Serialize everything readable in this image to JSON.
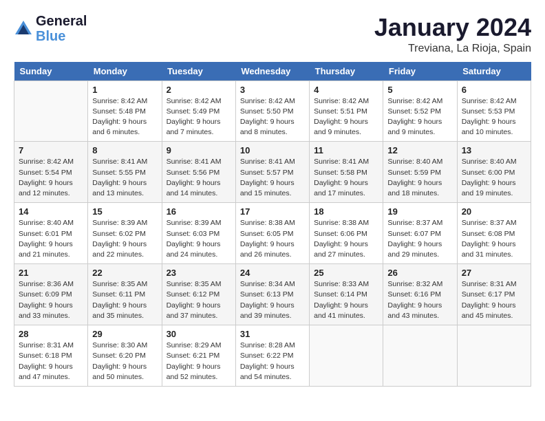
{
  "header": {
    "logo_line1": "General",
    "logo_line2": "Blue",
    "month": "January 2024",
    "location": "Treviana, La Rioja, Spain"
  },
  "weekdays": [
    "Sunday",
    "Monday",
    "Tuesday",
    "Wednesday",
    "Thursday",
    "Friday",
    "Saturday"
  ],
  "weeks": [
    [
      {
        "day": "",
        "sunrise": "",
        "sunset": "",
        "daylight": ""
      },
      {
        "day": "1",
        "sunrise": "Sunrise: 8:42 AM",
        "sunset": "Sunset: 5:48 PM",
        "daylight": "Daylight: 9 hours and 6 minutes."
      },
      {
        "day": "2",
        "sunrise": "Sunrise: 8:42 AM",
        "sunset": "Sunset: 5:49 PM",
        "daylight": "Daylight: 9 hours and 7 minutes."
      },
      {
        "day": "3",
        "sunrise": "Sunrise: 8:42 AM",
        "sunset": "Sunset: 5:50 PM",
        "daylight": "Daylight: 9 hours and 8 minutes."
      },
      {
        "day": "4",
        "sunrise": "Sunrise: 8:42 AM",
        "sunset": "Sunset: 5:51 PM",
        "daylight": "Daylight: 9 hours and 9 minutes."
      },
      {
        "day": "5",
        "sunrise": "Sunrise: 8:42 AM",
        "sunset": "Sunset: 5:52 PM",
        "daylight": "Daylight: 9 hours and 9 minutes."
      },
      {
        "day": "6",
        "sunrise": "Sunrise: 8:42 AM",
        "sunset": "Sunset: 5:53 PM",
        "daylight": "Daylight: 9 hours and 10 minutes."
      }
    ],
    [
      {
        "day": "7",
        "sunrise": "Sunrise: 8:42 AM",
        "sunset": "Sunset: 5:54 PM",
        "daylight": "Daylight: 9 hours and 12 minutes."
      },
      {
        "day": "8",
        "sunrise": "Sunrise: 8:41 AM",
        "sunset": "Sunset: 5:55 PM",
        "daylight": "Daylight: 9 hours and 13 minutes."
      },
      {
        "day": "9",
        "sunrise": "Sunrise: 8:41 AM",
        "sunset": "Sunset: 5:56 PM",
        "daylight": "Daylight: 9 hours and 14 minutes."
      },
      {
        "day": "10",
        "sunrise": "Sunrise: 8:41 AM",
        "sunset": "Sunset: 5:57 PM",
        "daylight": "Daylight: 9 hours and 15 minutes."
      },
      {
        "day": "11",
        "sunrise": "Sunrise: 8:41 AM",
        "sunset": "Sunset: 5:58 PM",
        "daylight": "Daylight: 9 hours and 17 minutes."
      },
      {
        "day": "12",
        "sunrise": "Sunrise: 8:40 AM",
        "sunset": "Sunset: 5:59 PM",
        "daylight": "Daylight: 9 hours and 18 minutes."
      },
      {
        "day": "13",
        "sunrise": "Sunrise: 8:40 AM",
        "sunset": "Sunset: 6:00 PM",
        "daylight": "Daylight: 9 hours and 19 minutes."
      }
    ],
    [
      {
        "day": "14",
        "sunrise": "Sunrise: 8:40 AM",
        "sunset": "Sunset: 6:01 PM",
        "daylight": "Daylight: 9 hours and 21 minutes."
      },
      {
        "day": "15",
        "sunrise": "Sunrise: 8:39 AM",
        "sunset": "Sunset: 6:02 PM",
        "daylight": "Daylight: 9 hours and 22 minutes."
      },
      {
        "day": "16",
        "sunrise": "Sunrise: 8:39 AM",
        "sunset": "Sunset: 6:03 PM",
        "daylight": "Daylight: 9 hours and 24 minutes."
      },
      {
        "day": "17",
        "sunrise": "Sunrise: 8:38 AM",
        "sunset": "Sunset: 6:05 PM",
        "daylight": "Daylight: 9 hours and 26 minutes."
      },
      {
        "day": "18",
        "sunrise": "Sunrise: 8:38 AM",
        "sunset": "Sunset: 6:06 PM",
        "daylight": "Daylight: 9 hours and 27 minutes."
      },
      {
        "day": "19",
        "sunrise": "Sunrise: 8:37 AM",
        "sunset": "Sunset: 6:07 PM",
        "daylight": "Daylight: 9 hours and 29 minutes."
      },
      {
        "day": "20",
        "sunrise": "Sunrise: 8:37 AM",
        "sunset": "Sunset: 6:08 PM",
        "daylight": "Daylight: 9 hours and 31 minutes."
      }
    ],
    [
      {
        "day": "21",
        "sunrise": "Sunrise: 8:36 AM",
        "sunset": "Sunset: 6:09 PM",
        "daylight": "Daylight: 9 hours and 33 minutes."
      },
      {
        "day": "22",
        "sunrise": "Sunrise: 8:35 AM",
        "sunset": "Sunset: 6:11 PM",
        "daylight": "Daylight: 9 hours and 35 minutes."
      },
      {
        "day": "23",
        "sunrise": "Sunrise: 8:35 AM",
        "sunset": "Sunset: 6:12 PM",
        "daylight": "Daylight: 9 hours and 37 minutes."
      },
      {
        "day": "24",
        "sunrise": "Sunrise: 8:34 AM",
        "sunset": "Sunset: 6:13 PM",
        "daylight": "Daylight: 9 hours and 39 minutes."
      },
      {
        "day": "25",
        "sunrise": "Sunrise: 8:33 AM",
        "sunset": "Sunset: 6:14 PM",
        "daylight": "Daylight: 9 hours and 41 minutes."
      },
      {
        "day": "26",
        "sunrise": "Sunrise: 8:32 AM",
        "sunset": "Sunset: 6:16 PM",
        "daylight": "Daylight: 9 hours and 43 minutes."
      },
      {
        "day": "27",
        "sunrise": "Sunrise: 8:31 AM",
        "sunset": "Sunset: 6:17 PM",
        "daylight": "Daylight: 9 hours and 45 minutes."
      }
    ],
    [
      {
        "day": "28",
        "sunrise": "Sunrise: 8:31 AM",
        "sunset": "Sunset: 6:18 PM",
        "daylight": "Daylight: 9 hours and 47 minutes."
      },
      {
        "day": "29",
        "sunrise": "Sunrise: 8:30 AM",
        "sunset": "Sunset: 6:20 PM",
        "daylight": "Daylight: 9 hours and 50 minutes."
      },
      {
        "day": "30",
        "sunrise": "Sunrise: 8:29 AM",
        "sunset": "Sunset: 6:21 PM",
        "daylight": "Daylight: 9 hours and 52 minutes."
      },
      {
        "day": "31",
        "sunrise": "Sunrise: 8:28 AM",
        "sunset": "Sunset: 6:22 PM",
        "daylight": "Daylight: 9 hours and 54 minutes."
      },
      {
        "day": "",
        "sunrise": "",
        "sunset": "",
        "daylight": ""
      },
      {
        "day": "",
        "sunrise": "",
        "sunset": "",
        "daylight": ""
      },
      {
        "day": "",
        "sunrise": "",
        "sunset": "",
        "daylight": ""
      }
    ]
  ]
}
